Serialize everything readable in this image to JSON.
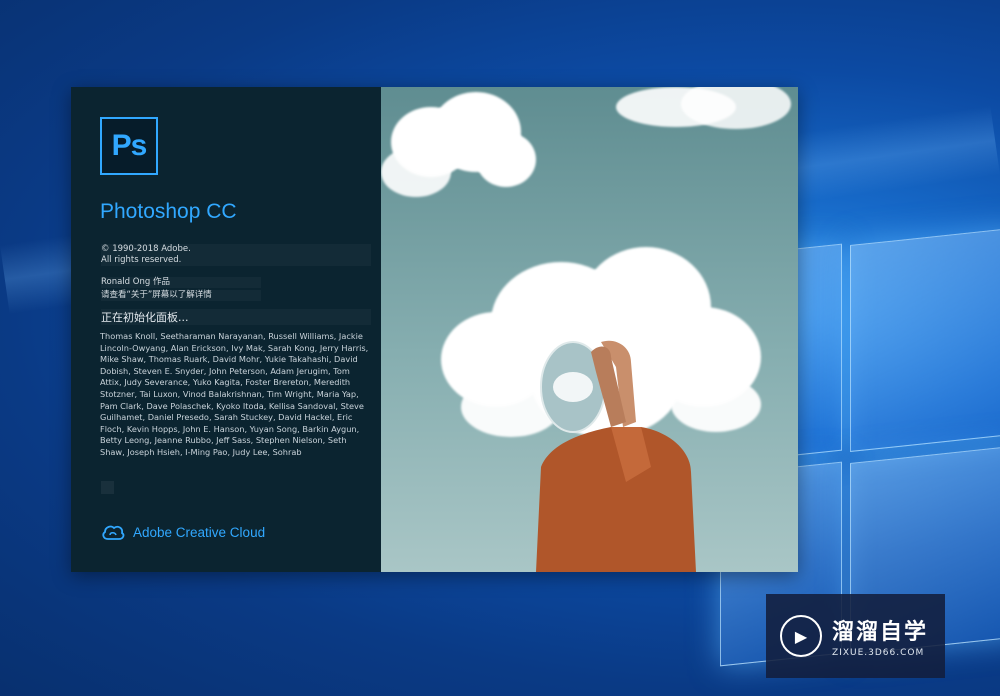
{
  "splash": {
    "logo_text": "Ps",
    "product_name": "Photoshop CC",
    "copyright_line1": "© 1990-2018 Adobe.",
    "copyright_line2": "All rights reserved.",
    "artwork_credit": "Ronald Ong 作品",
    "about_hint": "请查看“关于”屏幕以了解详情",
    "status": "正在初始化面板...",
    "credits": "Thomas Knoll, Seetharaman Narayanan, Russell Williams, Jackie Lincoln-Owyang, Alan Erickson, Ivy Mak, Sarah Kong, Jerry Harris, Mike Shaw, Thomas Ruark, David Mohr, Yukie Takahashi, David Dobish, Steven E. Snyder, John Peterson, Adam Jerugim, Tom Attix, Judy Severance, Yuko Kagita, Foster Brereton, Meredith Stotzner, Tai Luxon, Vinod Balakrishnan, Tim Wright, Maria Yap, Pam Clark, Dave Polaschek, Kyoko Itoda, Kellisa Sandoval, Steve Guilhamet, Daniel Presedo, Sarah Stuckey, David Hackel, Eric Floch, Kevin Hopps, John E. Hanson, Yuyan Song, Barkin Aygun, Betty Leong, Jeanne Rubbo, Jeff Sass, Stephen Nielson, Seth Shaw, Joseph Hsieh, I-Ming Pao, Judy Lee, Sohrab",
    "cloud_brand": "Adobe Creative Cloud"
  },
  "watermark": {
    "text": "溜溜自学",
    "url": "ZIXUE.3D66.COM"
  },
  "colors": {
    "accent": "#31a8ff",
    "panel": "#0b2430"
  },
  "icons": [
    "photoshop-logo-icon",
    "creative-cloud-icon",
    "play-logo-icon"
  ]
}
